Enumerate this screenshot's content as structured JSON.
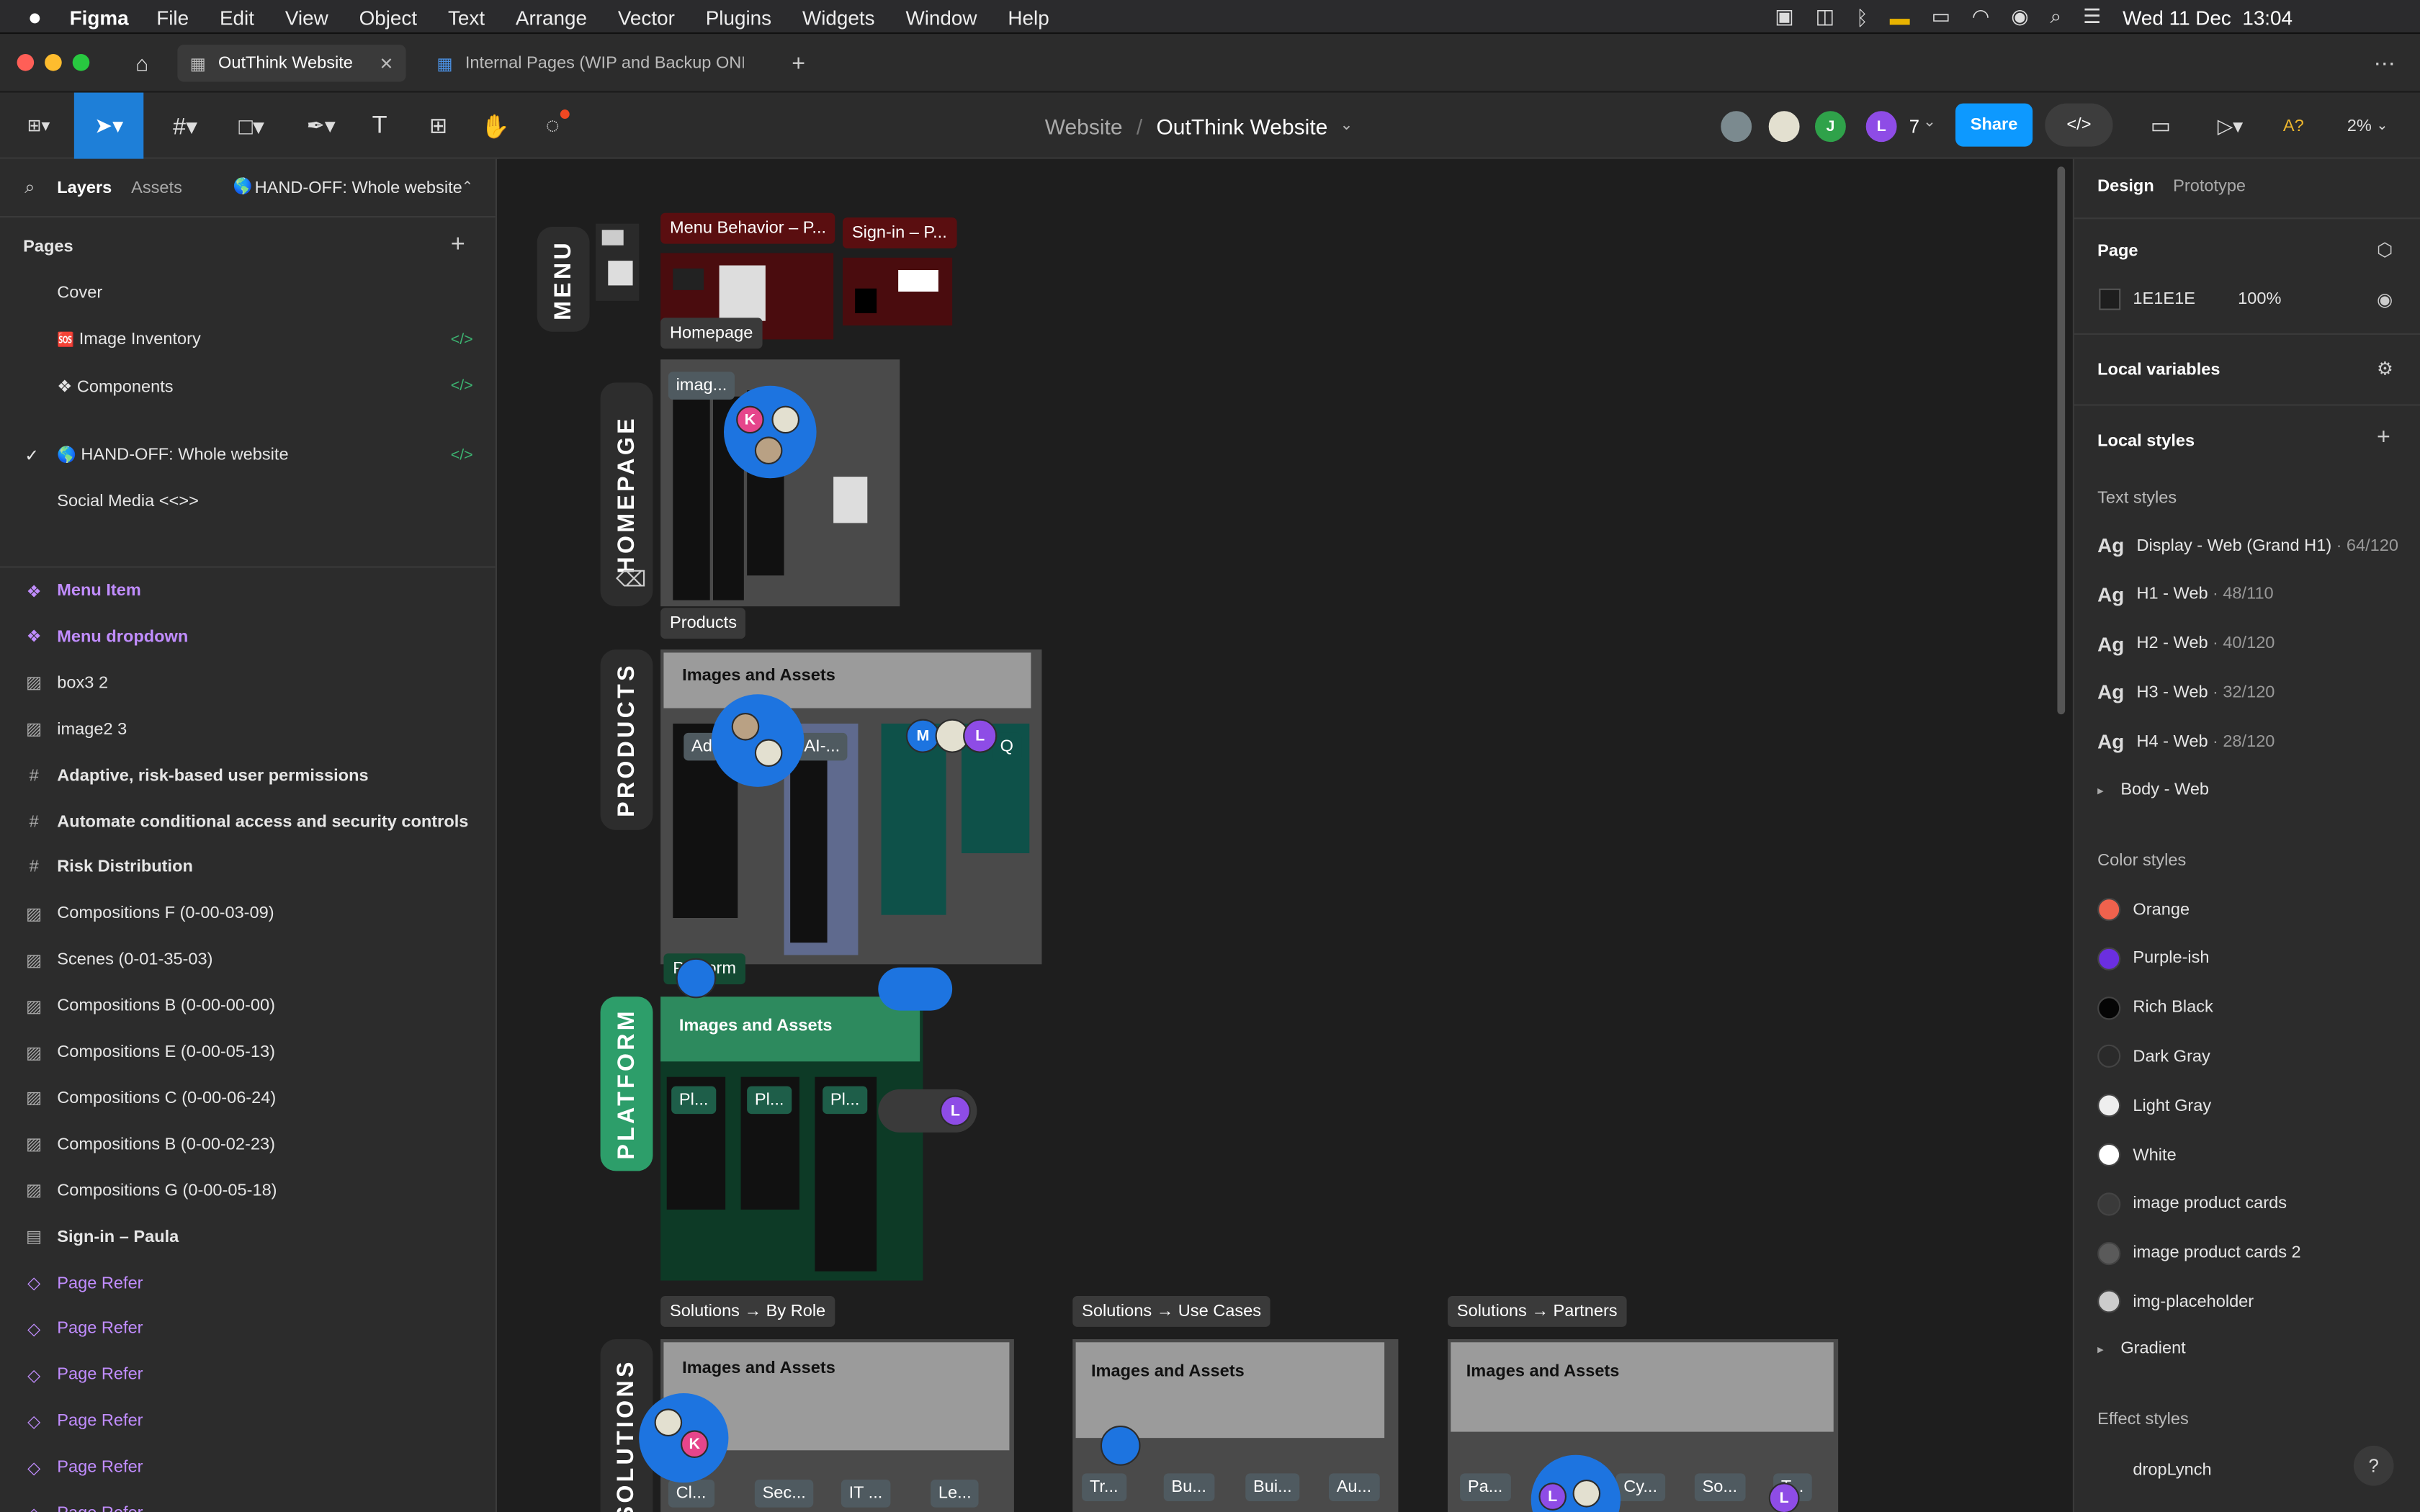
{
  "menubar": {
    "app": "Figma",
    "items": [
      "File",
      "Edit",
      "View",
      "Object",
      "Text",
      "Arrange",
      "Vector",
      "Plugins",
      "Widgets",
      "Window",
      "Help"
    ],
    "clock": "Wed 11 Dec  13:04"
  },
  "tabs": {
    "active": "OutThink Website",
    "second": "Internal Pages (WIP and Backup ONL"
  },
  "toolbar": {
    "breadcrumb_parent": "Website",
    "breadcrumb_sep": "/",
    "file_name": "OutThink Website",
    "collab_count": "7",
    "share": "Share",
    "zoom": "2%",
    "font_warning": "A?",
    "avatar_j": "J",
    "avatar_l": "L"
  },
  "left": {
    "tab_layers": "Layers",
    "tab_assets": "Assets",
    "page_selector": "HAND-OFF: Whole website",
    "pages_title": "Pages",
    "pages": [
      {
        "label": "Cover",
        "code": false,
        "check": false,
        "prefix": ""
      },
      {
        "label": "Image Inventory",
        "code": true,
        "check": false,
        "prefix": "🆘"
      },
      {
        "label": "Components",
        "code": true,
        "check": false,
        "prefix": "❖"
      },
      {
        "label": "HAND-OFF: Whole website",
        "code": true,
        "check": true,
        "prefix": "🌎"
      },
      {
        "label": "Social Media <<>>",
        "code": false,
        "check": false,
        "prefix": ""
      }
    ],
    "layers": [
      {
        "label": "Menu Item",
        "icon": "component",
        "purple": true,
        "bold": true
      },
      {
        "label": "Menu dropdown",
        "icon": "component",
        "purple": true,
        "bold": true
      },
      {
        "label": "box3 2",
        "icon": "image",
        "purple": false,
        "bold": false
      },
      {
        "label": "image2 3",
        "icon": "image",
        "purple": false,
        "bold": false
      },
      {
        "label": "Adaptive, risk-based user permissions",
        "icon": "frame",
        "purple": false,
        "bold": true
      },
      {
        "label": "Automate conditional access and security controls",
        "icon": "frame",
        "purple": false,
        "bold": true
      },
      {
        "label": "Risk Distribution",
        "icon": "frame",
        "purple": false,
        "bold": true
      },
      {
        "label": "Compositions F (0-00-03-09)",
        "icon": "image",
        "purple": false,
        "bold": false
      },
      {
        "label": "Scenes (0-01-35-03)",
        "icon": "image",
        "purple": false,
        "bold": false
      },
      {
        "label": "Compositions B (0-00-00-00)",
        "icon": "image",
        "purple": false,
        "bold": false
      },
      {
        "label": "Compositions E (0-00-05-13)",
        "icon": "image",
        "purple": false,
        "bold": false
      },
      {
        "label": "Compositions C (0-00-06-24)",
        "icon": "image",
        "purple": false,
        "bold": false
      },
      {
        "label": "Compositions B (0-00-02-23)",
        "icon": "image",
        "purple": false,
        "bold": false
      },
      {
        "label": "Compositions G (0-00-05-18)",
        "icon": "image",
        "purple": false,
        "bold": false
      },
      {
        "label": "Sign-in – Paula",
        "icon": "section",
        "purple": false,
        "bold": true
      },
      {
        "label": "Page Refer",
        "icon": "instance",
        "purple": true,
        "bold": false
      },
      {
        "label": "Page Refer",
        "icon": "instance",
        "purple": true,
        "bold": false
      },
      {
        "label": "Page Refer",
        "icon": "instance",
        "purple": true,
        "bold": false
      },
      {
        "label": "Page Refer",
        "icon": "instance",
        "purple": true,
        "bold": false
      },
      {
        "label": "Page Refer",
        "icon": "instance",
        "purple": true,
        "bold": false
      },
      {
        "label": "Page Refer",
        "icon": "instance",
        "purple": true,
        "bold": false
      }
    ]
  },
  "right": {
    "tab_design": "Design",
    "tab_prototype": "Prototype",
    "page_title": "Page",
    "page_color": "1E1E1E",
    "page_opacity": "100%",
    "local_variables": "Local variables",
    "local_styles": "Local styles",
    "text_styles_title": "Text styles",
    "text_styles": [
      {
        "name": "Display - Web (Grand H1)",
        "meta": "64/120"
      },
      {
        "name": "H1 - Web",
        "meta": "48/110"
      },
      {
        "name": "H2 - Web",
        "meta": "40/120"
      },
      {
        "name": "H3 - Web",
        "meta": "32/120"
      },
      {
        "name": "H4 - Web",
        "meta": "28/120"
      }
    ],
    "ag": "Ag",
    "body_group": "Body - Web",
    "color_styles_title": "Color styles",
    "color_styles": [
      {
        "name": "Orange",
        "color": "#f0624d"
      },
      {
        "name": "Purple-ish",
        "color": "#6b2fe0"
      },
      {
        "name": "Rich Black",
        "color": "#050505"
      },
      {
        "name": "Dark Gray",
        "color": "#2a2a2a"
      },
      {
        "name": "Light Gray",
        "color": "#eeeeee"
      },
      {
        "name": "White",
        "color": "#ffffff"
      },
      {
        "name": "image product cards",
        "color": "#3a3a3a"
      },
      {
        "name": "image product cards 2",
        "color": "#5a5a5a"
      },
      {
        "name": "img-placeholder",
        "color": "#cccccc"
      }
    ],
    "gradient_group": "Gradient",
    "effect_styles_title": "Effect styles",
    "effect": "dropLynch",
    "help": "?"
  },
  "canvas": {
    "sections": {
      "menu": "MENU",
      "homepage": "HOMEPAGE",
      "products": "PRODUCTS",
      "platform": "PLATFORM",
      "solutions": "SOLUTIONS"
    },
    "frames": {
      "menu_behavior": "Menu Behavior – P...",
      "signin": "Sign-in – P...",
      "homepage": "Homepage",
      "products": "Products",
      "platform": "Platform",
      "by_role": "Solutions → By Role",
      "use_cases": "Solutions → Use Cases",
      "partners": "Solutions → Partners"
    },
    "images_and_assets": "Images and Assets",
    "chips": {
      "imag": "imag...",
      "ad": "Ad",
      "ai": "AI-...",
      "q": "Q",
      "pl1": "Pl...",
      "pl2": "Pl...",
      "pl3": "Pl...",
      "cl": "Cl...",
      "sec": "Sec...",
      "it": "IT ...",
      "le": "Le...",
      "tr": "Tr...",
      "bu": "Bu...",
      "bui": "Bui...",
      "au": "Au...",
      "pa": "Pa...",
      "cy": "Cy...",
      "so": "So...",
      "t": "T..."
    },
    "avatars": {
      "k": "K",
      "m": "M",
      "l": "L"
    }
  },
  "colors": {
    "accent": "#1e7fd8",
    "platform_green": "#2d9e6a",
    "section_bg": "#2d2d2d",
    "layer_purple": "#c18dff"
  }
}
